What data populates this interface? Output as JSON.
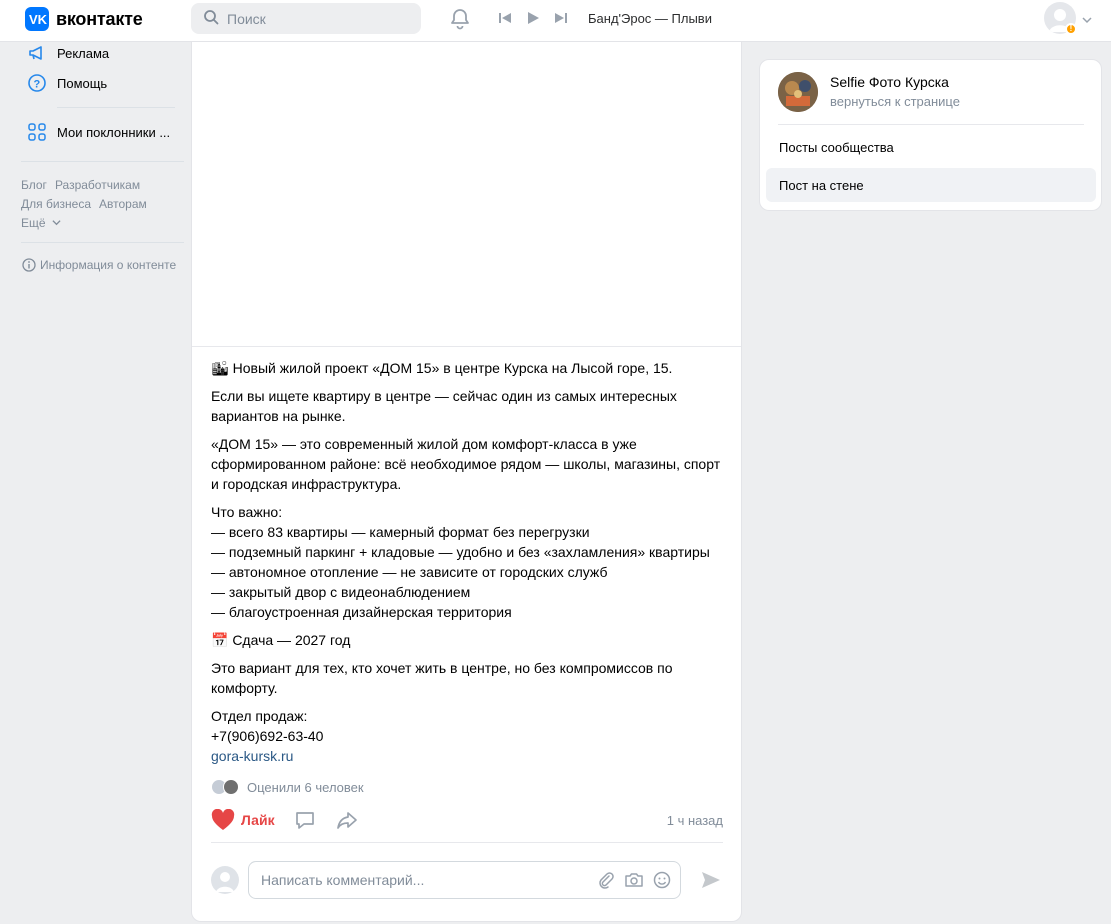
{
  "header": {
    "logo_text": "вконтакте",
    "search_placeholder": "Поиск",
    "track": "Банд'Эрос — Плыви"
  },
  "sidebar": {
    "items": [
      {
        "label": "Реклама",
        "icon": "megaphone-icon"
      },
      {
        "label": "Помощь",
        "icon": "help-icon"
      },
      {
        "label": "Мои поклонники ...",
        "icon": "apps-icon"
      }
    ],
    "footer_links": [
      "Блог",
      "Разработчикам",
      "Для бизнеса",
      "Авторам",
      "Ещё"
    ],
    "info": "Информация о контенте"
  },
  "post": {
    "paragraphs": [
      "🏙 Новый жилой проект «ДОМ 15» в центре Курска на Лысой горе, 15.",
      "Если вы ищете квартиру в центре — сейчас один из самых интересных вариантов на рынке.",
      "«ДОМ 15» — это современный жилой дом комфорт-класса в уже сформированном районе: всё необходимое рядом — школы, магазины, спорт и городская инфраструктура."
    ],
    "important_title": "Что важно:",
    "important_list": [
      "— всего 83 квартиры — камерный формат без перегрузки",
      "— подземный паркинг + кладовые — удобно и без «захламления» квартиры",
      "— автономное отопление — не зависите от городских служб",
      "— закрытый двор с видеонаблюдением",
      "— благоустроенная дизайнерская территория"
    ],
    "deadline": "📅 Сдача — 2027 год",
    "closing": "Это вариант для тех, кто хочет жить в центре, но без компромиссов по комфорту.",
    "sales_title": "Отдел продаж:",
    "phone": "+7(906)692-63-40",
    "site": "gora-kursk.ru",
    "rated": "Оценили 6 человек",
    "like_label": "Лайк",
    "time": "1 ч назад",
    "comment_placeholder": "Написать комментарий..."
  },
  "panel": {
    "group_name": "Selfie Фото Курска",
    "back_link": "вернуться к странице",
    "items": [
      "Посты сообщества",
      "Пост на стене"
    ]
  },
  "colors": {
    "accent": "#0077ff",
    "like": "#e64646",
    "muted": "#818c99",
    "link": "#2a5885"
  }
}
